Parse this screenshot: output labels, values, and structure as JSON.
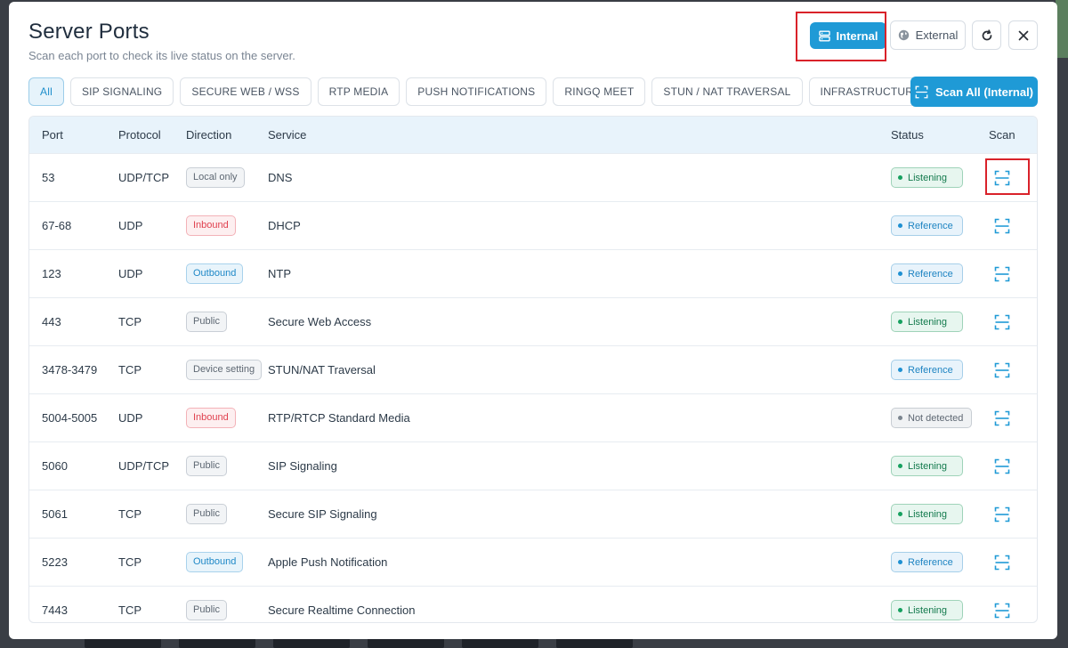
{
  "header": {
    "title": "Server Ports",
    "subtitle": "Scan each port to check its live status on the server.",
    "internal_label": "Internal",
    "external_label": "External"
  },
  "filters": [
    "All",
    "SIP SIGNALING",
    "SECURE WEB / WSS",
    "RTP MEDIA",
    "PUSH NOTIFICATIONS",
    "RINGQ MEET",
    "STUN / NAT TRAVERSAL",
    "INFRASTRUCTURE"
  ],
  "active_filter": "All",
  "scan_all_label": "Scan All (Internal)",
  "table": {
    "columns": {
      "port": "Port",
      "protocol": "Protocol",
      "direction": "Direction",
      "service": "Service",
      "status": "Status",
      "scan": "Scan"
    },
    "rows": [
      {
        "port": "53",
        "protocol": "UDP/TCP",
        "direction": "Local only",
        "dir_type": "local",
        "service": "DNS",
        "status": "Listening",
        "status_type": "listening"
      },
      {
        "port": "67-68",
        "protocol": "UDP",
        "direction": "Inbound",
        "dir_type": "inbound",
        "service": "DHCP",
        "status": "Reference",
        "status_type": "reference"
      },
      {
        "port": "123",
        "protocol": "UDP",
        "direction": "Outbound",
        "dir_type": "outbound",
        "service": "NTP",
        "status": "Reference",
        "status_type": "reference"
      },
      {
        "port": "443",
        "protocol": "TCP",
        "direction": "Public",
        "dir_type": "public",
        "service": "Secure Web Access",
        "status": "Listening",
        "status_type": "listening"
      },
      {
        "port": "3478-3479",
        "protocol": "TCP",
        "direction": "Device setting",
        "dir_type": "device",
        "service": "STUN/NAT Traversal",
        "status": "Reference",
        "status_type": "reference"
      },
      {
        "port": "5004-5005",
        "protocol": "UDP",
        "direction": "Inbound",
        "dir_type": "inbound",
        "service": "RTP/RTCP Standard Media",
        "status": "Not detected",
        "status_type": "notdetected"
      },
      {
        "port": "5060",
        "protocol": "UDP/TCP",
        "direction": "Public",
        "dir_type": "public",
        "service": "SIP Signaling",
        "status": "Listening",
        "status_type": "listening"
      },
      {
        "port": "5061",
        "protocol": "TCP",
        "direction": "Public",
        "dir_type": "public",
        "service": "Secure SIP Signaling",
        "status": "Listening",
        "status_type": "listening"
      },
      {
        "port": "5223",
        "protocol": "TCP",
        "direction": "Outbound",
        "dir_type": "outbound",
        "service": "Apple Push Notification",
        "status": "Reference",
        "status_type": "reference"
      },
      {
        "port": "7443",
        "protocol": "TCP",
        "direction": "Public",
        "dir_type": "public",
        "service": "Secure Realtime Connection",
        "status": "Listening",
        "status_type": "listening"
      }
    ]
  },
  "icons": {
    "internal": "server-icon",
    "external": "globe-icon",
    "refresh": "refresh-icon",
    "close": "close-icon",
    "scan": "scan-icon"
  },
  "colors": {
    "accent": "#1f9ad6",
    "highlight": "#d9222a",
    "listening": "#16a05f",
    "reference": "#1e90d2",
    "inbound": "#e0414f"
  }
}
